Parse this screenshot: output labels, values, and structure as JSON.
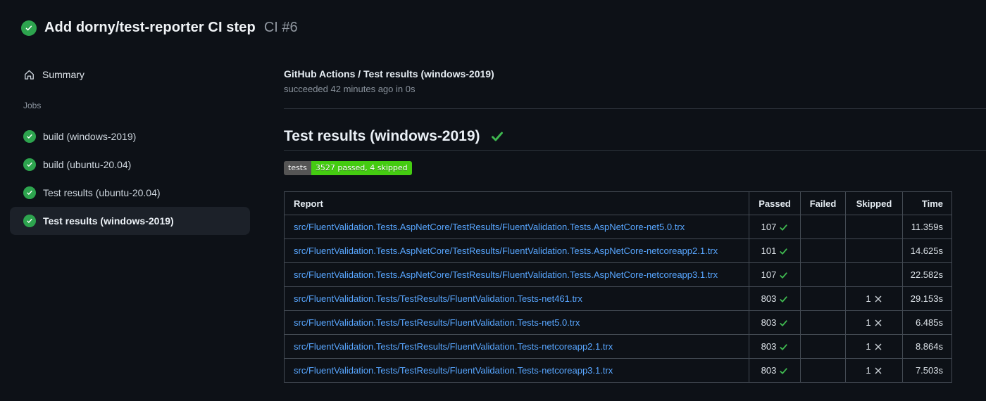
{
  "header": {
    "title": "Add dorny/test-reporter CI step",
    "run_number": "CI #6"
  },
  "sidebar": {
    "summary_label": "Summary",
    "jobs_label": "Jobs",
    "jobs": [
      {
        "label": "build (windows-2019)",
        "selected": false
      },
      {
        "label": "build (ubuntu-20.04)",
        "selected": false
      },
      {
        "label": "Test results (ubuntu-20.04)",
        "selected": false
      },
      {
        "label": "Test results (windows-2019)",
        "selected": true
      }
    ]
  },
  "main": {
    "check_run_title": "GitHub Actions / Test results (windows-2019)",
    "check_run_status": "succeeded 42 minutes ago in 0s",
    "section_title": "Test results (windows-2019)",
    "badge": {
      "label": "tests",
      "status": "3527 passed, 4 skipped",
      "label_bg": "#555555",
      "status_bg": "#44cc11"
    },
    "results_table": {
      "columns": {
        "report": "Report",
        "passed": "Passed",
        "failed": "Failed",
        "skipped": "Skipped",
        "time": "Time"
      },
      "rows": [
        {
          "report": "src/FluentValidation.Tests.AspNetCore/TestResults/FluentValidation.Tests.AspNetCore-net5.0.trx",
          "passed": "107",
          "failed": "",
          "skipped": "",
          "time": "11.359s"
        },
        {
          "report": "src/FluentValidation.Tests.AspNetCore/TestResults/FluentValidation.Tests.AspNetCore-netcoreapp2.1.trx",
          "passed": "101",
          "failed": "",
          "skipped": "",
          "time": "14.625s"
        },
        {
          "report": "src/FluentValidation.Tests.AspNetCore/TestResults/FluentValidation.Tests.AspNetCore-netcoreapp3.1.trx",
          "passed": "107",
          "failed": "",
          "skipped": "",
          "time": "22.582s"
        },
        {
          "report": "src/FluentValidation.Tests/TestResults/FluentValidation.Tests-net461.trx",
          "passed": "803",
          "failed": "",
          "skipped": "1",
          "time": "29.153s"
        },
        {
          "report": "src/FluentValidation.Tests/TestResults/FluentValidation.Tests-net5.0.trx",
          "passed": "803",
          "failed": "",
          "skipped": "1",
          "time": "6.485s"
        },
        {
          "report": "src/FluentValidation.Tests/TestResults/FluentValidation.Tests-netcoreapp2.1.trx",
          "passed": "803",
          "failed": "",
          "skipped": "1",
          "time": "8.864s"
        },
        {
          "report": "src/FluentValidation.Tests/TestResults/FluentValidation.Tests-netcoreapp3.1.trx",
          "passed": "803",
          "failed": "",
          "skipped": "1",
          "time": "7.503s"
        }
      ]
    }
  },
  "colors": {
    "background": "#0d1117",
    "success_green": "#2da44e",
    "check_green": "#3fb950",
    "link_blue": "#58a6ff",
    "table_border": "#434a53",
    "selected_item_bg": "#1c2129",
    "muted_text": "#8b949e"
  }
}
